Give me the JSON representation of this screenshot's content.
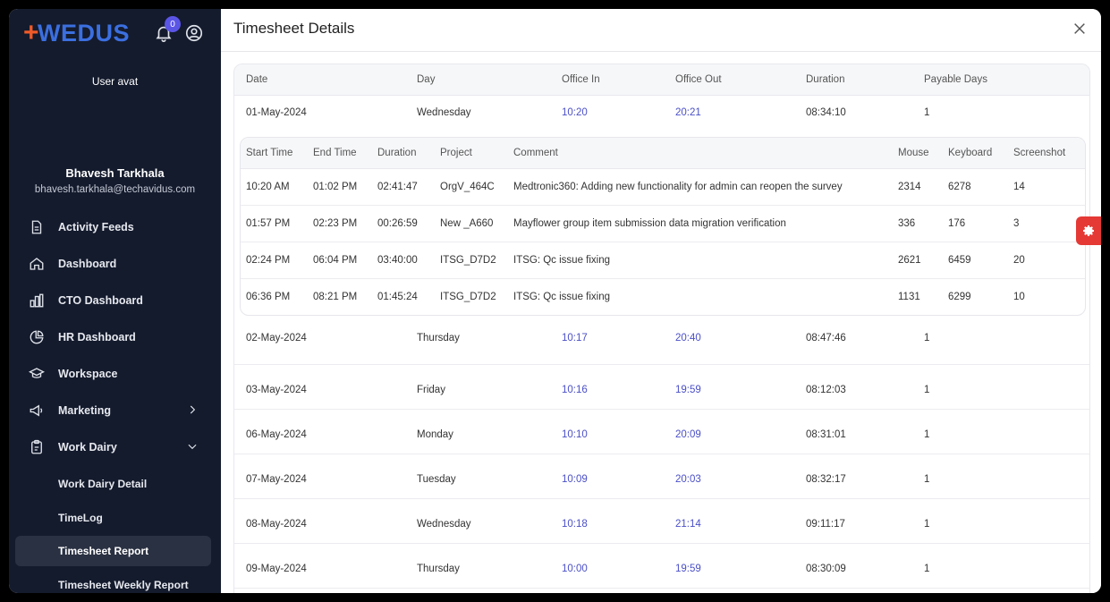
{
  "app": {
    "logo_text": "WEDUS",
    "logo_mark": "+",
    "notification_count": "0",
    "avatar_alt": "User avat",
    "user_name": "Bhavesh Tarkhala",
    "user_email": "bhavesh.tarkhala@techavidus.com"
  },
  "sidebar": {
    "items": [
      {
        "label": "Activity Feeds",
        "icon": "document-icon"
      },
      {
        "label": "Dashboard",
        "icon": "home-icon"
      },
      {
        "label": "CTO Dashboard",
        "icon": "bar-chart-icon"
      },
      {
        "label": "HR Dashboard",
        "icon": "pie-chart-icon"
      },
      {
        "label": "Workspace",
        "icon": "graduation-cap-icon"
      },
      {
        "label": "Marketing",
        "icon": "megaphone-icon"
      },
      {
        "label": "Work Dairy",
        "icon": "clipboard-icon"
      }
    ],
    "sub_items": [
      {
        "label": "Work Dairy Detail"
      },
      {
        "label": "TimeLog"
      },
      {
        "label": "Timesheet Report",
        "active": true
      },
      {
        "label": "Timesheet Weekly Report"
      }
    ]
  },
  "modal": {
    "title": "Timesheet Details",
    "columns": [
      "Date",
      "Day",
      "Office In",
      "Office Out",
      "Duration",
      "Payable Days"
    ],
    "first_row": {
      "date": "01-May-2024",
      "day": "Wednesday",
      "in": "10:20",
      "out": "20:21",
      "duration": "08:34:10",
      "payable": "1"
    },
    "detail": {
      "columns": [
        "Start Time",
        "End Time",
        "Duration",
        "Project",
        "Comment",
        "Mouse",
        "Keyboard",
        "Screenshot"
      ],
      "rows": [
        {
          "start": "10:20 AM",
          "end": "01:02 PM",
          "duration": "02:41:47",
          "project": "OrgV_464C",
          "comment": "Medtronic360: Adding new functionality for admin can reopen the survey",
          "mouse": "2314",
          "keyboard": "6278",
          "screenshot": "14"
        },
        {
          "start": "01:57 PM",
          "end": "02:23 PM",
          "duration": "00:26:59",
          "project": "New _A660",
          "comment": "Mayflower group item submission data migration verification",
          "mouse": "336",
          "keyboard": "176",
          "screenshot": "3"
        },
        {
          "start": "02:24 PM",
          "end": "06:04 PM",
          "duration": "03:40:00",
          "project": "ITSG_D7D2",
          "comment": "ITSG: Qc issue fixing",
          "mouse": "2621",
          "keyboard": "6459",
          "screenshot": "20"
        },
        {
          "start": "06:36 PM",
          "end": "08:21 PM",
          "duration": "01:45:24",
          "project": "ITSG_D7D2",
          "comment": "ITSG: Qc issue fixing",
          "mouse": "1131",
          "keyboard": "6299",
          "screenshot": "10"
        }
      ]
    },
    "rows": [
      {
        "date": "02-May-2024",
        "day": "Thursday",
        "in": "10:17",
        "out": "20:40",
        "duration": "08:47:46",
        "payable": "1"
      },
      {
        "date": "03-May-2024",
        "day": "Friday",
        "in": "10:16",
        "out": "19:59",
        "duration": "08:12:03",
        "payable": "1"
      },
      {
        "date": "06-May-2024",
        "day": "Monday",
        "in": "10:10",
        "out": "20:09",
        "duration": "08:31:01",
        "payable": "1"
      },
      {
        "date": "07-May-2024",
        "day": "Tuesday",
        "in": "10:09",
        "out": "20:03",
        "duration": "08:32:17",
        "payable": "1"
      },
      {
        "date": "08-May-2024",
        "day": "Wednesday",
        "in": "10:18",
        "out": "21:14",
        "duration": "09:11:17",
        "payable": "1"
      },
      {
        "date": "09-May-2024",
        "day": "Thursday",
        "in": "10:00",
        "out": "19:59",
        "duration": "08:30:09",
        "payable": "1"
      }
    ]
  },
  "colors": {
    "sidebar_bg": "#141b2d",
    "link": "#4a4fc8",
    "accent_red": "#e53935",
    "logo_blue": "#3b6fe0",
    "logo_orange": "#f05a28"
  }
}
